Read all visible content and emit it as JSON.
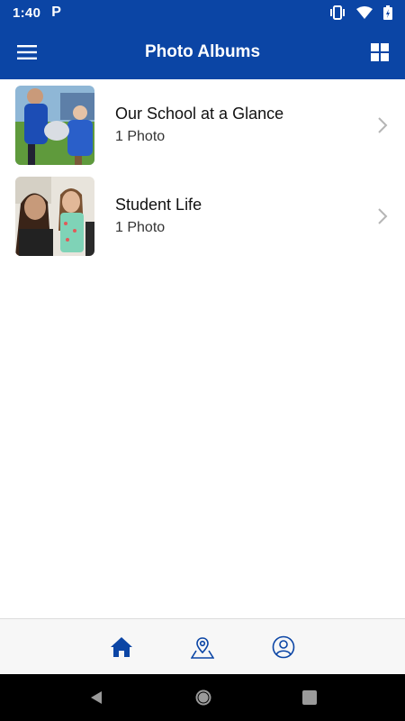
{
  "status_bar": {
    "time": "1:40",
    "app_badge": "P"
  },
  "app_bar": {
    "title": "Photo Albums"
  },
  "albums": [
    {
      "title": "Our School at a Glance",
      "count": "1 Photo"
    },
    {
      "title": "Student Life",
      "count": "1 Photo"
    }
  ],
  "bottom_nav": {
    "items": [
      "home-icon",
      "map-location-icon",
      "profile-icon"
    ]
  },
  "colors": {
    "primary": "#0b45a5",
    "nav_icon": "#0b45a5"
  }
}
